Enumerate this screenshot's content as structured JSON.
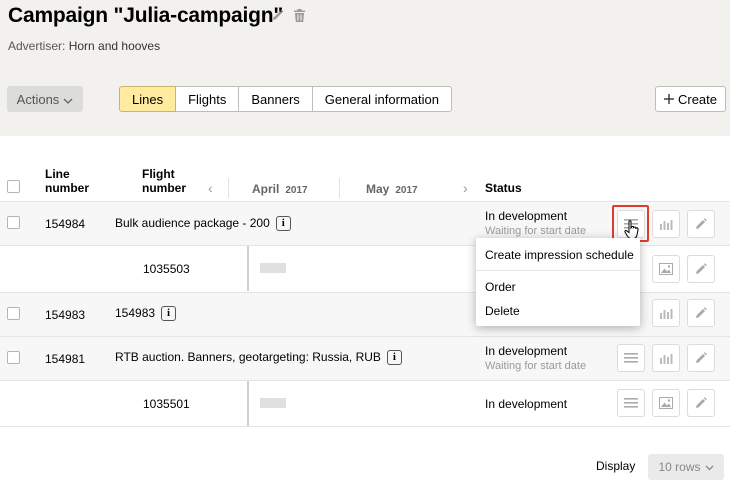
{
  "header": {
    "title": "Campaign \"Julia-campaign\"",
    "advertiser_label": "Advertiser:",
    "advertiser_name": "Horn and hooves",
    "actions_label": "Actions",
    "tabs": [
      {
        "label": "Lines",
        "active": true
      },
      {
        "label": "Flights",
        "active": false
      },
      {
        "label": "Banners",
        "active": false
      },
      {
        "label": "General information",
        "active": false
      }
    ],
    "create_label": "Create"
  },
  "table": {
    "col_line": "Line\nnumber",
    "col_line_1": "Line",
    "col_line_2": "number",
    "col_flight_1": "Flight",
    "col_flight_2": "number",
    "month1": "April",
    "month1_year": "2017",
    "month2": "May",
    "month2_year": "2017",
    "col_status": "Status",
    "rows": [
      {
        "line": "154984",
        "name": "Bulk audience package - 200",
        "status": "In development",
        "status_sub": "Waiting for start date"
      },
      {
        "flight": "1035503"
      },
      {
        "line": "154983",
        "name": "154983"
      },
      {
        "line": "154981",
        "name": "RTB auction. Banners, geotargeting: Russia, RUB",
        "status": "In development",
        "status_sub": "Waiting for start date"
      },
      {
        "flight": "1035501",
        "status": "In development"
      }
    ]
  },
  "menu": {
    "items": [
      "Create impression schedule",
      "Order",
      "Delete"
    ]
  },
  "footer": {
    "display_label": "Display",
    "rows_select": "10 rows"
  },
  "colors": {
    "accent_tab": "#ffeba0",
    "highlight": "#e03b2f",
    "header_bg": "#f2f1ee"
  },
  "icons": [
    "pencil-icon",
    "trash-icon",
    "chevron-down-icon",
    "plus-icon",
    "info-icon",
    "list-icon",
    "bar-chart-icon",
    "image-icon",
    "cursor-hand-icon"
  ]
}
